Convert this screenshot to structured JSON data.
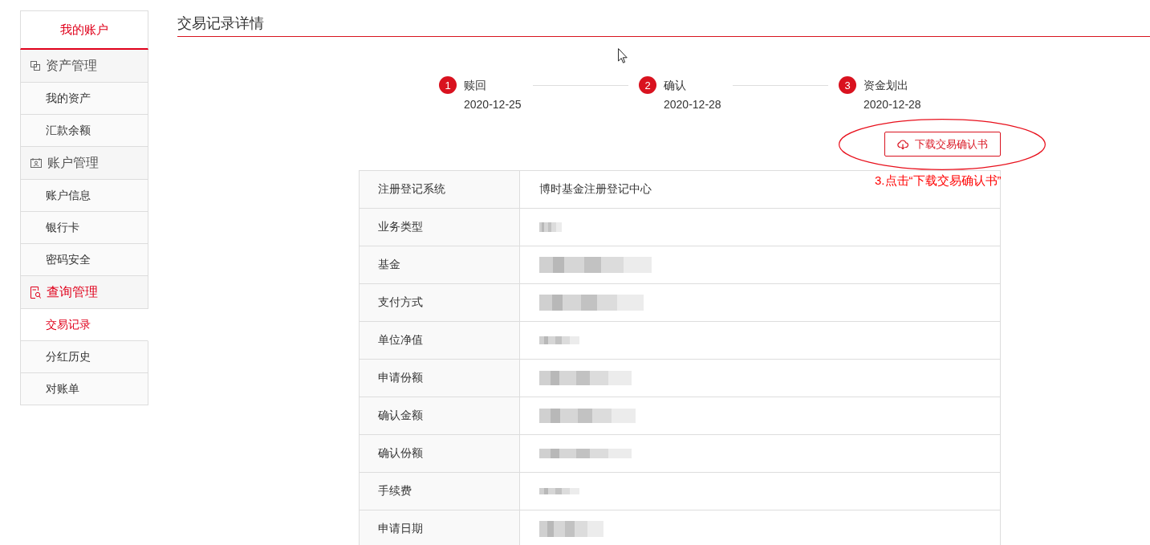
{
  "sidebar": {
    "title": "我的账户",
    "groups": [
      {
        "label": "资产管理",
        "selected": false,
        "items": [
          {
            "label": "我的资产",
            "selected": false
          },
          {
            "label": "汇款余额",
            "selected": false
          }
        ]
      },
      {
        "label": "账户管理",
        "selected": false,
        "items": [
          {
            "label": "账户信息",
            "selected": false
          },
          {
            "label": "银行卡",
            "selected": false
          },
          {
            "label": "密码安全",
            "selected": false
          }
        ]
      },
      {
        "label": "查询管理",
        "selected": true,
        "items": [
          {
            "label": "交易记录",
            "selected": true
          },
          {
            "label": "分红历史",
            "selected": false
          },
          {
            "label": "对账单",
            "selected": false
          }
        ]
      }
    ]
  },
  "page_title": "交易记录详情",
  "steps": [
    {
      "number": "1",
      "label": "赎回",
      "date": "2020-12-25"
    },
    {
      "number": "2",
      "label": "确认",
      "date": "2020-12-28"
    },
    {
      "number": "3",
      "label": "资金划出",
      "date": "2020-12-28"
    }
  ],
  "download_button": {
    "label": "下载交易确认书"
  },
  "annotation": {
    "text": "3.点击“下载交易确认书”"
  },
  "details": [
    {
      "label": "注册登记系统",
      "kind": "text",
      "value": "博时基金注册登记中心"
    },
    {
      "label": "业务类型",
      "kind": "blurred"
    },
    {
      "label": "基金",
      "kind": "blurred"
    },
    {
      "label": "支付方式",
      "kind": "blurred"
    },
    {
      "label": "单位净值",
      "kind": "blurred"
    },
    {
      "label": "申请份额",
      "kind": "blurred"
    },
    {
      "label": "确认金额",
      "kind": "blurred"
    },
    {
      "label": "确认份额",
      "kind": "blurred"
    },
    {
      "label": "手续费",
      "kind": "blurred"
    },
    {
      "label": "申请日期",
      "kind": "blurred"
    }
  ]
}
